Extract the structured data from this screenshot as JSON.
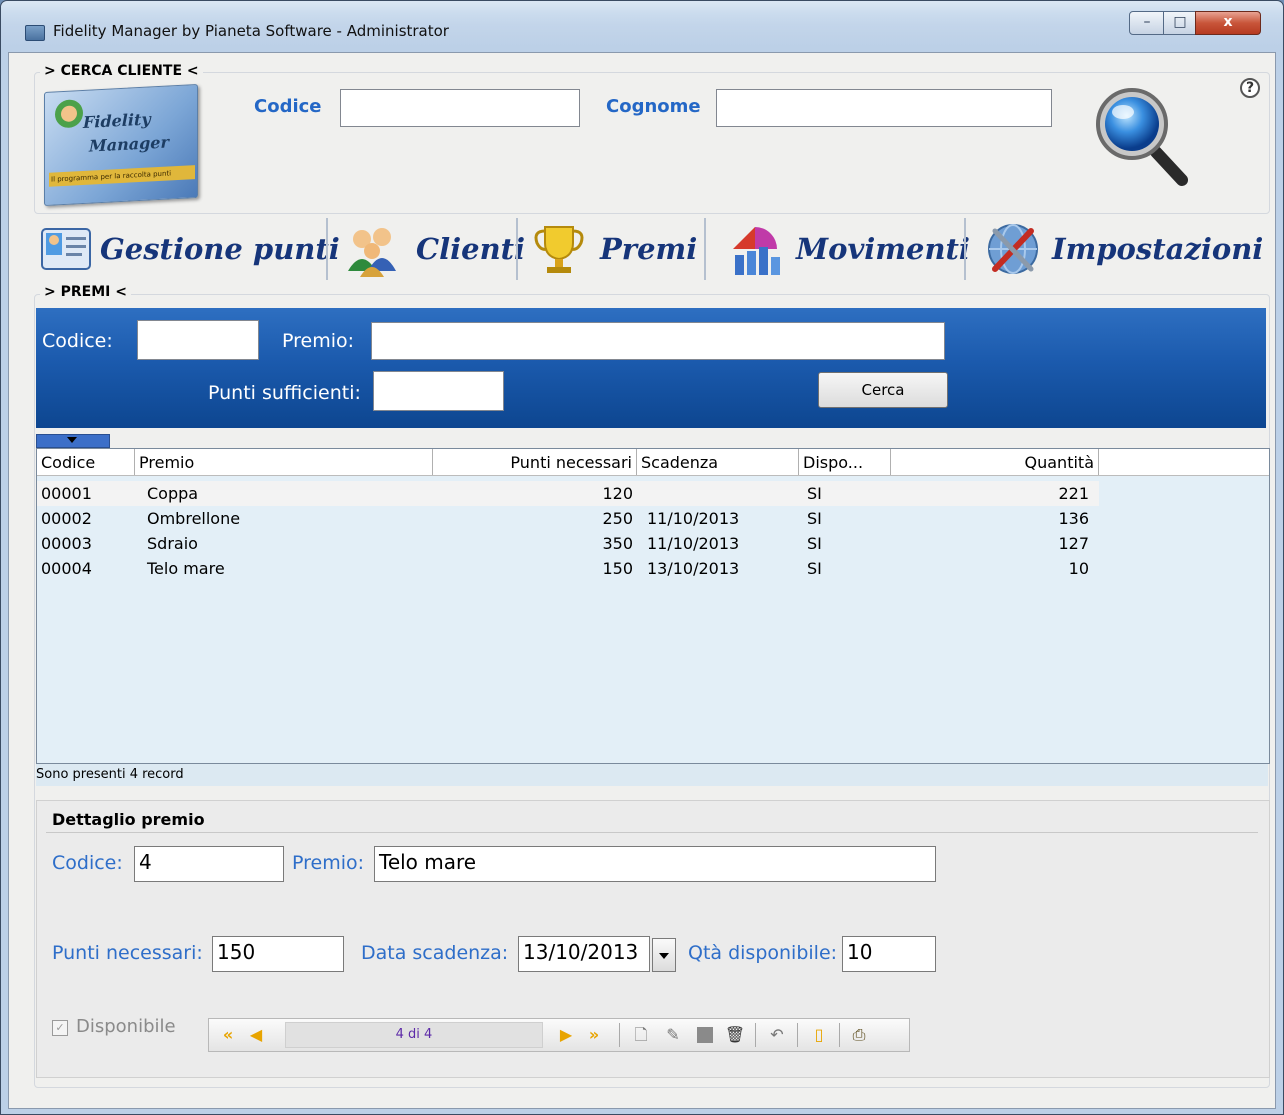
{
  "window": {
    "title": "Fidelity Manager by Pianeta Software - Administrator",
    "minimize": "–",
    "maximize": "□",
    "close": "x"
  },
  "cerca_cliente": {
    "legend": "> CERCA CLIENTE <",
    "codice_label": "Codice",
    "codice_value": "",
    "cognome_label": "Cognome",
    "cognome_value": "",
    "help": "?"
  },
  "logo": {
    "line1": "Fidelity",
    "line2": "Manager",
    "tagline": "Il programma per la raccolta punti"
  },
  "nav": [
    {
      "label": "Gestione punti",
      "icon": "card-icon"
    },
    {
      "label": "Clienti",
      "icon": "users-icon"
    },
    {
      "label": "Premi",
      "icon": "trophy-icon"
    },
    {
      "label": "Movimenti",
      "icon": "chart-icon"
    },
    {
      "label": "Impostazioni",
      "icon": "settings-icon"
    }
  ],
  "premi": {
    "legend": "> PREMI <",
    "codice_label": "Codice:",
    "premio_label": "Premio:",
    "punti_label": "Punti sufficienti:",
    "cerca_button": "Cerca"
  },
  "grid": {
    "columns": [
      "Codice",
      "Premio",
      "Punti necessari",
      "Scadenza",
      "Dispo...",
      "Quantità"
    ],
    "rows": [
      [
        "00001",
        "Coppa",
        "120",
        "",
        "SI",
        "221"
      ],
      [
        "00002",
        "Ombrellone",
        "250",
        "11/10/2013",
        "SI",
        "136"
      ],
      [
        "00003",
        "Sdraio",
        "350",
        "11/10/2013",
        "SI",
        "127"
      ],
      [
        "00004",
        "Telo mare",
        "150",
        "13/10/2013",
        "SI",
        "10"
      ]
    ],
    "status": "Sono presenti 4 record"
  },
  "detail": {
    "title": "Dettaglio premio",
    "codice_label": "Codice:",
    "codice_value": "4",
    "premio_label": "Premio:",
    "premio_value": "Telo mare",
    "punti_label": "Punti necessari:",
    "punti_value": "150",
    "scadenza_label": "Data scadenza:",
    "scadenza_value": "13/10/2013",
    "qta_label": "Qtà disponibile:",
    "qta_value": "10",
    "disponibile_label": "Disponibile",
    "record_position": "4 di 4"
  },
  "colors": {
    "accent_blue": "#2467c6",
    "nav_text": "#16357a",
    "band_top": "#2e6fc1",
    "band_bottom": "#0d4690",
    "navbar_icons": "#e8a400"
  }
}
